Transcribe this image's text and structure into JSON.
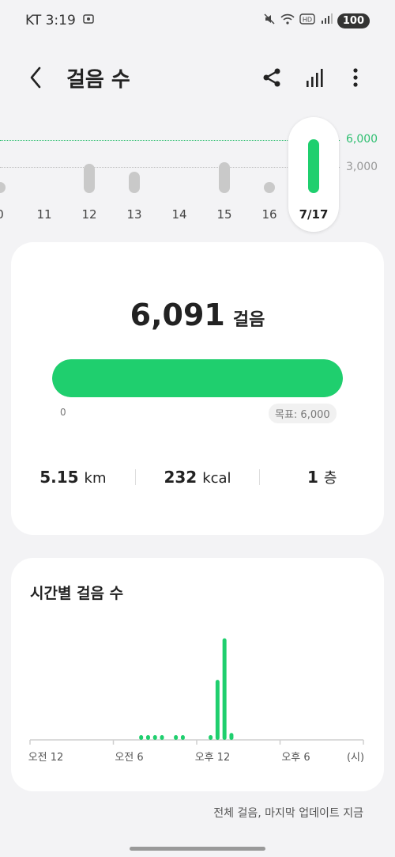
{
  "status_bar": {
    "carrier_time": "KT 3:19",
    "icons": [
      "screenshot-icon",
      "mute-icon",
      "wifi-icon",
      "hd-icon",
      "signal-icon"
    ],
    "battery": "100"
  },
  "header": {
    "title": "걸음 수",
    "icons": [
      "back-icon",
      "share-icon",
      "stats-icon",
      "more-icon"
    ]
  },
  "day_chart": {
    "grid_top": "6,000",
    "grid_mid": "3,000",
    "days": [
      {
        "label": "0",
        "value": 700,
        "red": false
      },
      {
        "label": "11",
        "value": 0,
        "red": false
      },
      {
        "label": "12",
        "value": 3300,
        "red": false
      },
      {
        "label": "13",
        "value": 2400,
        "red": false
      },
      {
        "label": "14",
        "value": 0,
        "red": false
      },
      {
        "label": "15",
        "value": 3500,
        "red": false
      },
      {
        "label": "16",
        "value": 1100,
        "red": false
      }
    ],
    "selected": {
      "label": "7/17",
      "value": 6091
    },
    "accent": "#1fcf6e",
    "muted": "#c9c9c9",
    "sunday_color": "#d33c3c"
  },
  "summary": {
    "steps": "6,091",
    "steps_unit": "걸음",
    "progress": 1.0,
    "min_label": "0",
    "goal_label": "목표: 6,000",
    "distance_value": "5.15",
    "distance_unit": "km",
    "calories_value": "232",
    "calories_unit": "kcal",
    "floors_value": "1",
    "floors_unit": "층"
  },
  "hourly": {
    "title": "시간별 걸음 수",
    "axis_labels": [
      "오전 12",
      "오전 6",
      "오후 12",
      "오후 6",
      "(시)"
    ],
    "hours": [
      {
        "hour": 8.0,
        "value": 60
      },
      {
        "hour": 8.5,
        "value": 60
      },
      {
        "hour": 9.0,
        "value": 60
      },
      {
        "hour": 9.5,
        "value": 60
      },
      {
        "hour": 10.5,
        "value": 60
      },
      {
        "hour": 11.0,
        "value": 60
      },
      {
        "hour": 13.0,
        "value": 100
      },
      {
        "hour": 13.5,
        "value": 1300
      },
      {
        "hour": 14.0,
        "value": 2200
      },
      {
        "hour": 14.5,
        "value": 150
      }
    ],
    "max_value": 2400
  },
  "footer": {
    "note": "전체 걸음, 마지막 업데이트 지금"
  }
}
